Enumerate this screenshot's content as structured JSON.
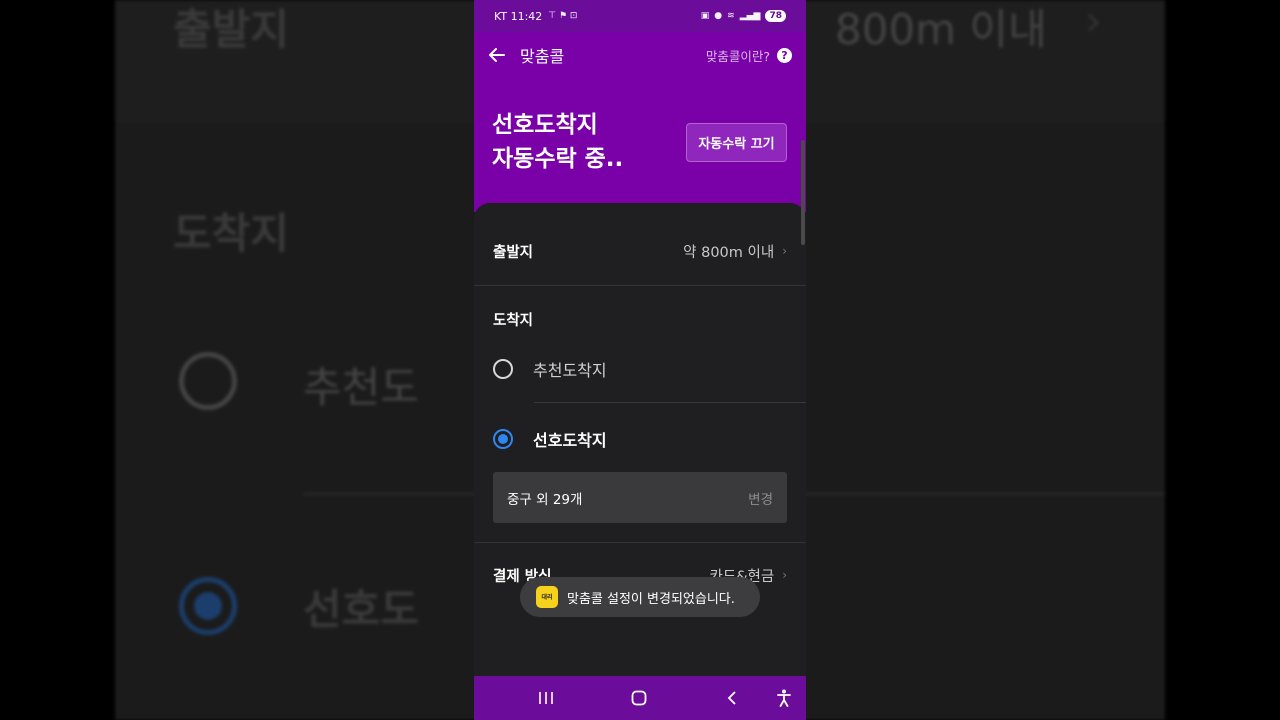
{
  "status_bar": {
    "carrier_time": "KT 11:42",
    "battery": "78"
  },
  "top_nav": {
    "title": "맞춤콜",
    "help_label": "맞춤콜이란?",
    "help_glyph": "?"
  },
  "hero": {
    "line1": "선호도착지",
    "line2": "자동수락 중..",
    "button_label": "자동수락 끄기"
  },
  "origin": {
    "label": "출발지",
    "value": "약 800m 이내"
  },
  "destination": {
    "title": "도착지",
    "options": [
      {
        "label": "추천도착지",
        "selected": false
      },
      {
        "label": "선호도착지",
        "selected": true
      }
    ],
    "summary": "중구 외 29개",
    "change_label": "변경"
  },
  "payment": {
    "label": "결제 방식",
    "value": "카드&현금"
  },
  "toast": {
    "logo_text": "대리",
    "message": "맞춤콜 설정이 변경되었습니다."
  },
  "background": {
    "origin_label": "출발지",
    "origin_value": "800m 이내",
    "dest_title": "도착지",
    "option1": "추천도",
    "option2": "선호도"
  },
  "colors": {
    "brand_purple": "#7a00a8",
    "selected_blue": "#2f86f0"
  },
  "icons": {
    "back": "arrow-left",
    "help": "question-circle",
    "nav_recent": "three-bars",
    "nav_home": "rounded-square",
    "nav_back": "chevron-left",
    "nav_accessibility": "person"
  }
}
